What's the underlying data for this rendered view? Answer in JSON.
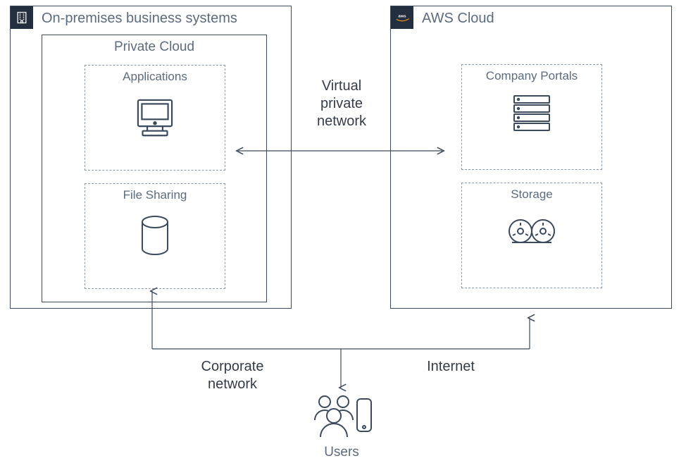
{
  "diagram": {
    "onprem": {
      "title": "On-premises business systems",
      "private_cloud": {
        "title": "Private Cloud",
        "applications": {
          "label": "Applications"
        },
        "file_sharing": {
          "label": "File Sharing"
        }
      }
    },
    "aws": {
      "title": "AWS Cloud",
      "company_portals": {
        "label": "Company Portals"
      },
      "storage": {
        "label": "Storage"
      }
    },
    "connectors": {
      "vpn": "Virtual\nprivate\nnetwork",
      "corporate": "Corporate\nnetwork",
      "internet": "Internet"
    },
    "users": {
      "label": "Users"
    }
  }
}
